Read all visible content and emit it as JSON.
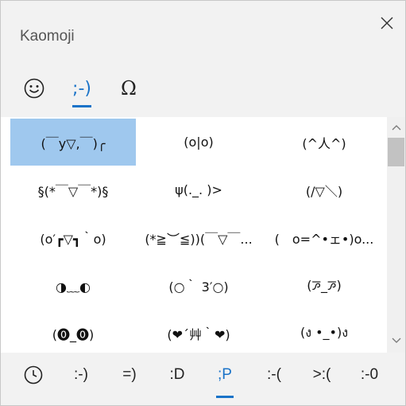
{
  "window": {
    "title": "Kaomoji",
    "close_icon": "close-icon"
  },
  "top_tabs": [
    {
      "name": "emoji",
      "icon": "smiley-icon",
      "label": ""
    },
    {
      "name": "kaomoji",
      "label": ";-)",
      "active": true
    },
    {
      "name": "symbols",
      "label": "Ω"
    }
  ],
  "kaomoji_grid": [
    [
      "(￣y▽,￣)╭",
      "(o|o)",
      "(^人^)"
    ],
    [
      "§(*￣▽￣*)§",
      "ψ(._. )>",
      "(/▽＼)"
    ],
    [
      "(o′┏▽┓｀o)",
      "(*≧︶≦))(￣▽￣...",
      "(　o=^•ェ•)o..."
    ],
    [
      "◑﹏◐",
      "(○｀ 3′○)",
      "(ꯍ_ꯍ)"
    ],
    [
      "(⓿_⓿)",
      "(❤´艸｀❤)",
      "(ง •_•)ง"
    ]
  ],
  "selected": {
    "row": 0,
    "col": 0
  },
  "bottom_tabs": [
    {
      "name": "recent",
      "icon": "clock-icon",
      "label": ""
    },
    {
      "name": "happy",
      "label": ":-)"
    },
    {
      "name": "smile",
      "label": "=)"
    },
    {
      "name": "laugh",
      "label": ":D"
    },
    {
      "name": "playful",
      "label": ";P",
      "active": true
    },
    {
      "name": "sad",
      "label": ":-("
    },
    {
      "name": "angry",
      "label": ">:("
    },
    {
      "name": "surprised",
      "label": ":-0"
    }
  ],
  "colors": {
    "accent": "#1a73c8",
    "selection": "#9fc8ee",
    "panel_bg": "#f2f2f2",
    "content_bg": "#ffffff"
  }
}
